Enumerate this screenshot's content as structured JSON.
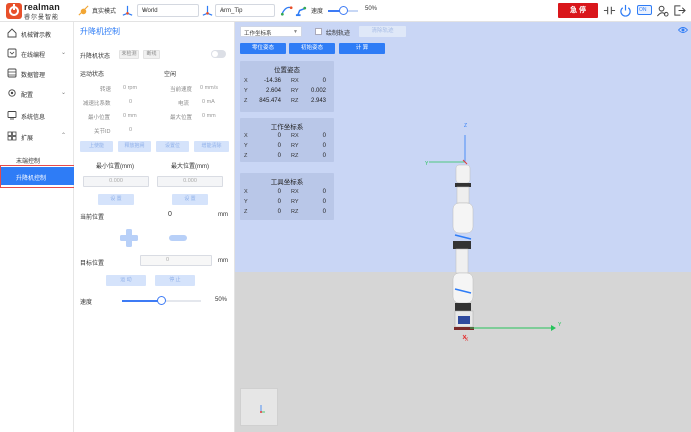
{
  "brand": {
    "name": "realman",
    "sub": "睿尔曼智能"
  },
  "toolbar": {
    "mode_label": "真实模式",
    "frame_select": "World",
    "tool_select": "Arm_Tip",
    "speed_label": "速度",
    "speed_value": "50%",
    "speed_fraction": 0.5,
    "estop_label": "急 停",
    "badge_text": "ON"
  },
  "sidebar": {
    "items": [
      {
        "label": "机械臂示教",
        "icon": "home-icon"
      },
      {
        "label": "在线编程",
        "icon": "code-icon"
      },
      {
        "label": "数据管理",
        "icon": "database-icon"
      },
      {
        "label": "配置",
        "icon": "gear-icon"
      },
      {
        "label": "系统信息",
        "icon": "monitor-icon"
      },
      {
        "label": "扩展",
        "icon": "grid-icon"
      }
    ],
    "sub_items": [
      {
        "label": "末端控制"
      },
      {
        "label": "升降机控制"
      }
    ]
  },
  "panel": {
    "title": "升降机控制",
    "status_label": "升降机状态",
    "status_chips": [
      "未检测",
      "断线"
    ],
    "motion_label": "运动状态",
    "motion_value": "空闲",
    "fields": {
      "speed_label": "转速",
      "speed_value": "0 rpm",
      "cur_speed_label": "当前速度",
      "cur_speed_value": "0 mm/s",
      "ratio_label": "减速比系数",
      "ratio_value": "0",
      "current_label": "电流",
      "current_value": "0 mA",
      "min_label": "最小位置",
      "min_value": "0 mm",
      "max_label": "最大位置",
      "max_value": "0 mm",
      "joint_label": "关节ID",
      "joint_value": "0"
    },
    "action_buttons": [
      "上使能",
      "释放抱闸",
      "设置位",
      "增能清除"
    ],
    "min_pos_label": "最小位置(mm)",
    "max_pos_label": "最大位置(mm)",
    "min_pos_value": "0.000",
    "max_pos_value": "0.000",
    "set_label": "设 置",
    "current_pos_label": "当前位置",
    "current_pos_value": "0",
    "unit_mm": "mm",
    "target_pos_label": "目标位置",
    "target_pos_value": "0",
    "move_label": "运 动",
    "stop_label": "停 止",
    "speed_label": "速度",
    "speed_value": "50%",
    "speed_fraction": 0.5
  },
  "view": {
    "frame_select": "工作坐标系",
    "track_label": "绘制轨迹",
    "clear_label": "清除轨迹",
    "btn_zero": "零位姿态",
    "btn_init": "初始姿态",
    "btn_calc": "计 算",
    "pose": {
      "title": "位置姿态",
      "rows": [
        {
          "k1": "X",
          "v1": "-14.36",
          "k2": "RX",
          "v2": "0"
        },
        {
          "k1": "Y",
          "v1": "2.604",
          "k2": "RY",
          "v2": "0.002"
        },
        {
          "k1": "Z",
          "v1": "845.474",
          "k2": "RZ",
          "v2": "2.943"
        }
      ]
    },
    "work": {
      "title": "工作坐标系",
      "rows": [
        {
          "k1": "X",
          "v1": "0",
          "k2": "RX",
          "v2": "0"
        },
        {
          "k1": "Y",
          "v1": "0",
          "k2": "RY",
          "v2": "0"
        },
        {
          "k1": "Z",
          "v1": "0",
          "k2": "RZ",
          "v2": "0"
        }
      ]
    },
    "tool": {
      "title": "工具坐标系",
      "rows": [
        {
          "k1": "X",
          "v1": "0",
          "k2": "RX",
          "v2": "0"
        },
        {
          "k1": "Y",
          "v1": "0",
          "k2": "RY",
          "v2": "0"
        },
        {
          "k1": "Z",
          "v1": "0",
          "k2": "RZ",
          "v2": "0"
        }
      ]
    },
    "axes": {
      "x": "X",
      "y": "Y",
      "z": "Z"
    }
  },
  "colors": {
    "accent": "#2e7cf6",
    "estop": "#d9161b",
    "sky": "#c9d6f5",
    "floor": "#d6d6d6"
  }
}
